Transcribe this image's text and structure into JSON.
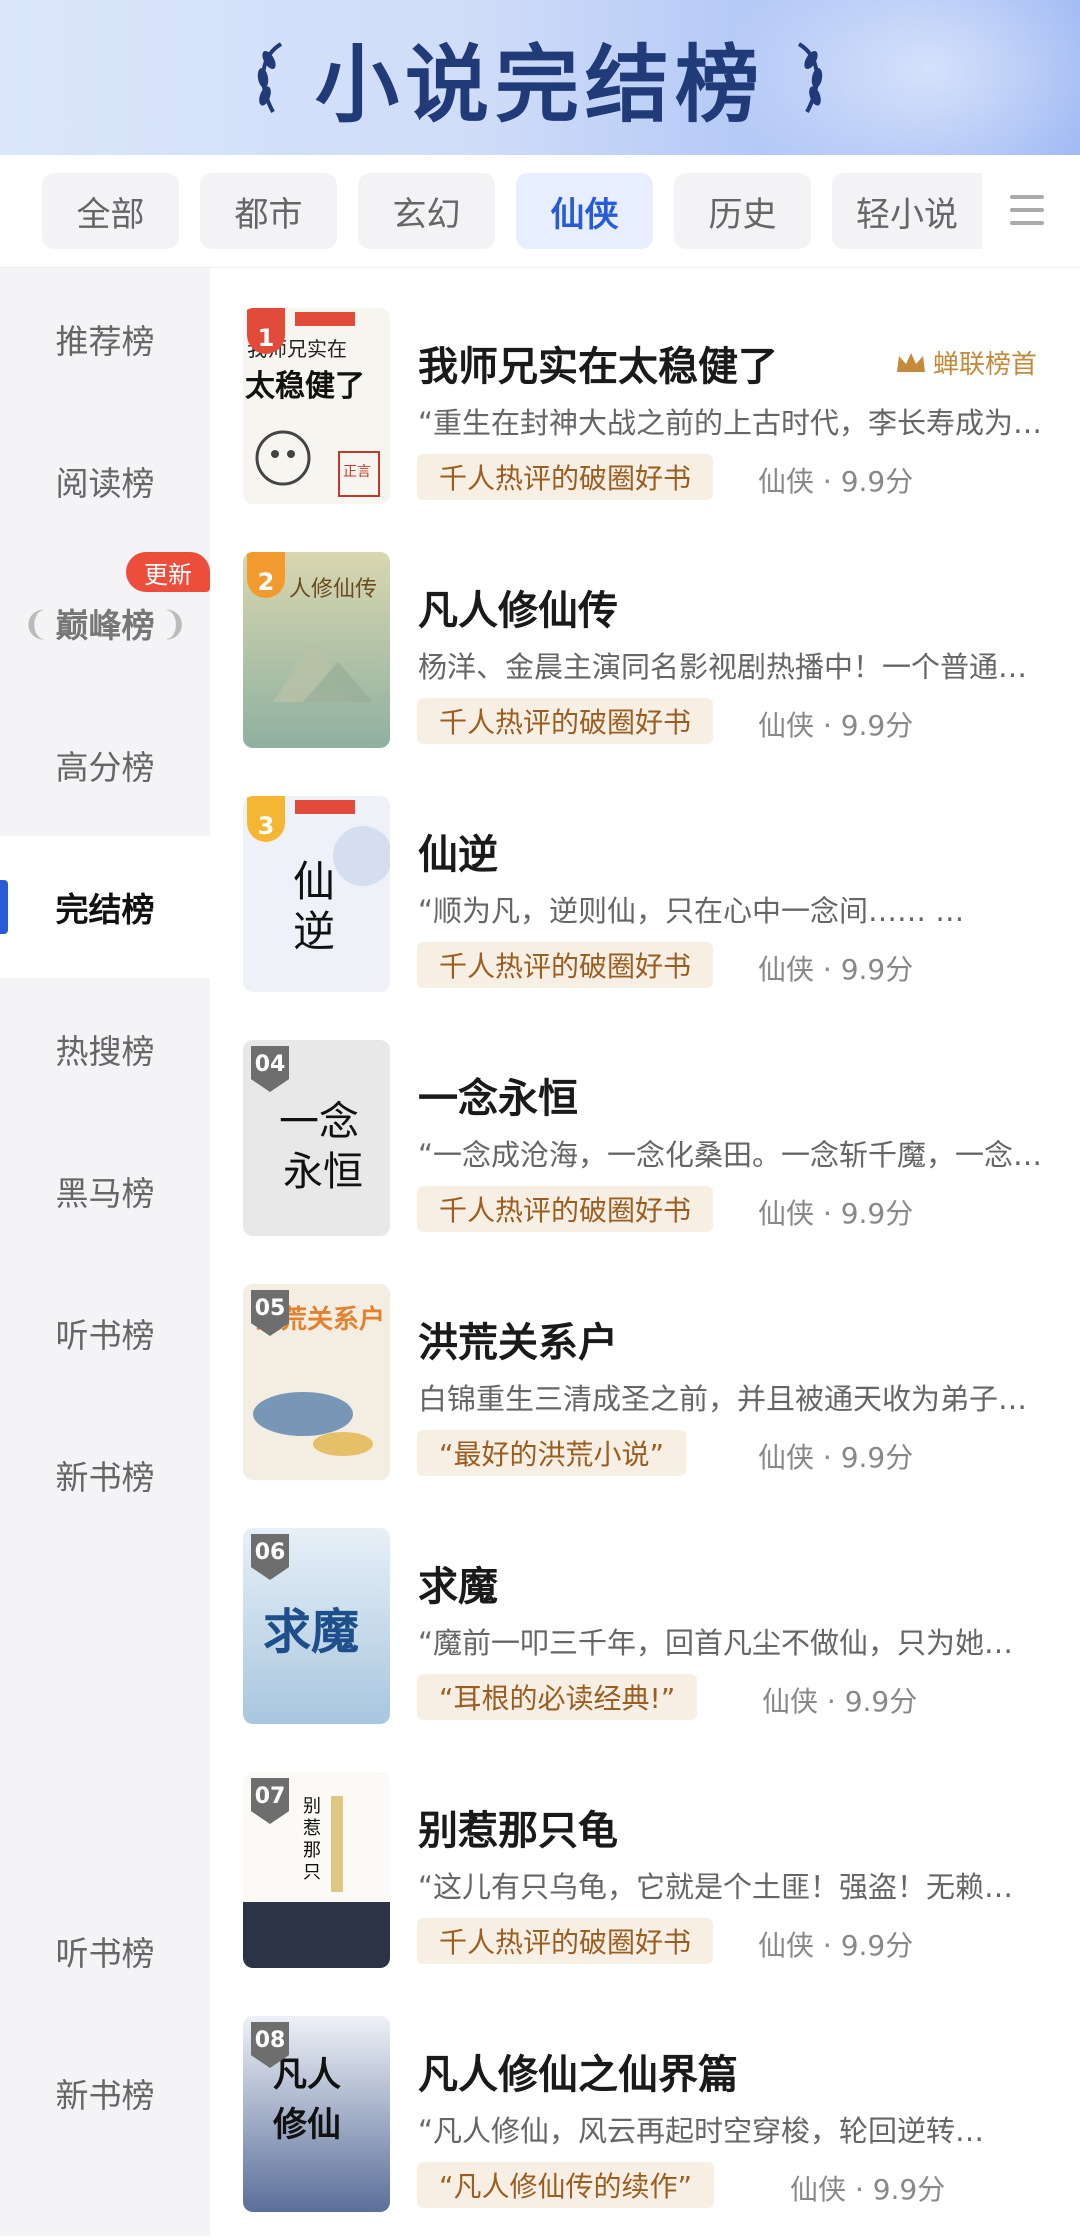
{
  "header": {
    "title": "小说完结榜"
  },
  "tabs": [
    {
      "label": "全部",
      "active": false
    },
    {
      "label": "都市",
      "active": false
    },
    {
      "label": "玄幻",
      "active": false
    },
    {
      "label": "仙侠",
      "active": true
    },
    {
      "label": "历史",
      "active": false
    },
    {
      "label": "轻小说",
      "active": false
    }
  ],
  "sidebar": {
    "items": [
      "推荐榜",
      "阅读榜",
      "巅峰榜",
      "高分榜",
      "完结榜",
      "热搜榜",
      "黑马榜",
      "听书榜",
      "新书榜",
      "听书榜",
      "新书榜"
    ],
    "active": "完结榜",
    "new_badge": "更新"
  },
  "books": [
    {
      "rank": "1",
      "title": "我师兄实在太稳健了",
      "desc": "“重生在封神大战之前的上古时代，李长寿成为了…",
      "tag": "千人热评的破圈好书",
      "category": "仙侠",
      "score": "9.9分",
      "crown": "蝉联榜首",
      "cover_text": "我师兄实在太稳健了"
    },
    {
      "rank": "2",
      "title": "凡人修仙传",
      "desc": "杨洋、金晨主演同名影视剧热播中！一个普通山村…",
      "tag": "千人热评的破圈好书",
      "category": "仙侠",
      "score": "9.9分",
      "cover_text": "凡人修仙传"
    },
    {
      "rank": "3",
      "title": "仙逆",
      "desc": "“顺为凡，逆则仙，只在心中一念间……   …",
      "tag": "千人热评的破圈好书",
      "category": "仙侠",
      "score": "9.9分",
      "cover_text": "仙逆"
    },
    {
      "rank": "04",
      "title": "一念永恒",
      "desc": "“一念成沧海，一念化桑田。一念斩千魔，一念诛…",
      "tag": "千人热评的破圈好书",
      "category": "仙侠",
      "score": "9.9分",
      "cover_text": "一念永恒"
    },
    {
      "rank": "05",
      "title": "洪荒关系户",
      "desc": "白锦重生三清成圣之前，并且被通天收为弟子…",
      "tag": "“最好的洪荒小说”",
      "category": "仙侠",
      "score": "9.9分",
      "cover_text": "洪荒关系户"
    },
    {
      "rank": "06",
      "title": "求魔",
      "desc": "“魔前一叩三千年，回首凡尘不做仙，只为她…",
      "tag": "“耳根的必读经典!”",
      "category": "仙侠",
      "score": "9.9分",
      "cover_text": "求魔"
    },
    {
      "rank": "07",
      "title": "别惹那只龟",
      "desc": "“这儿有只乌龟，它就是个土匪！强盗！无赖…",
      "tag": "千人热评的破圈好书",
      "category": "仙侠",
      "score": "9.9分",
      "cover_text": "别惹那只龟"
    },
    {
      "rank": "08",
      "title": "凡人修仙之仙界篇",
      "desc": "“凡人修仙，风云再起时空穿梭，轮回逆转…",
      "tag": "“凡人修仙传的续作”",
      "category": "仙侠",
      "score": "9.9分",
      "cover_text": "凡人修仙"
    }
  ],
  "colors": {
    "accent": "#2a5bd7",
    "rank1": "#e24a3a",
    "rank2": "#f29a2e",
    "rank3": "#f5b733",
    "tag_bg": "#f8efe4",
    "tag_text": "#9a5e22"
  }
}
